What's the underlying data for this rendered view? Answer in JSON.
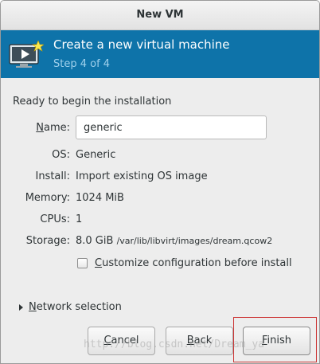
{
  "window": {
    "title": "New VM"
  },
  "banner": {
    "title": "Create a new virtual machine",
    "step": "Step 4 of 4",
    "icon": "vm-monitor-star-icon",
    "color": "#0e73a9"
  },
  "summary": {
    "heading": "Ready to begin the installation",
    "name_label": "Name:",
    "name_value": "generic",
    "os_label": "OS:",
    "os_value": "Generic",
    "install_label": "Install:",
    "install_value": "Import existing OS image",
    "memory_label": "Memory:",
    "memory_value": "1024 MiB",
    "cpus_label": "CPUs:",
    "cpus_value": "1",
    "storage_label": "Storage:",
    "storage_size": "8.0 GiB",
    "storage_path": "/var/lib/libvirt/images/dream.qcow2",
    "customize_label": "Customize configuration before install",
    "customize_checked": false
  },
  "network": {
    "label": "Network selection",
    "expanded": false
  },
  "buttons": {
    "cancel": "Cancel",
    "back": "Back",
    "finish": "Finish"
  },
  "watermark": "http://blog.csdn.net/Dream_ya",
  "colors": {
    "highlight_border": "#cc3333",
    "banner_step": "#9fd0ec"
  }
}
